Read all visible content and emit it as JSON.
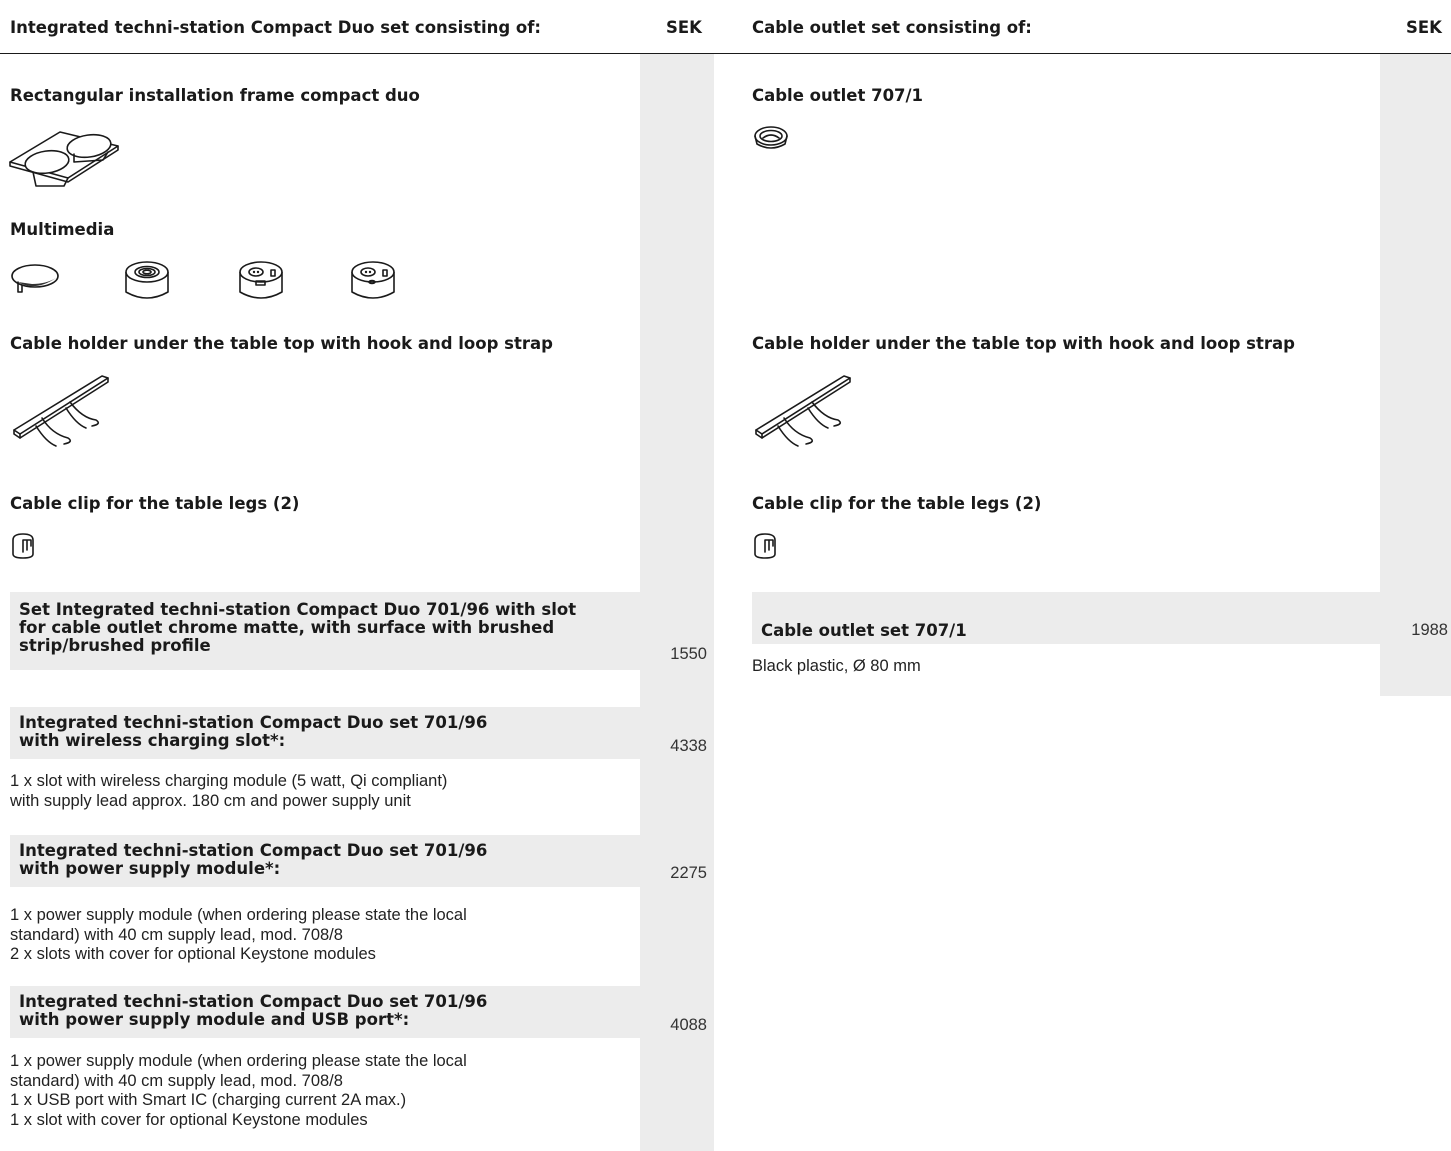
{
  "left": {
    "header": {
      "title": "Integrated techni-station Compact Duo set consisting of:",
      "currency": "SEK"
    },
    "sections": {
      "frame": "Rectangular installation frame compact duo",
      "multimedia": "Multimedia",
      "cable_holder": "Cable holder under the table top with hook and loop strap",
      "cable_clip": "Cable clip for the table legs (2)"
    },
    "items": [
      {
        "title_lines": [
          "Set Integrated techni-station Compact Duo 701/96 with slot",
          "for cable outlet chrome matte, with surface with brushed",
          "strip/brushed profile"
        ],
        "price": "1550",
        "desc_lines": []
      },
      {
        "title_lines": [
          "Integrated techni-station Compact Duo set 701/96",
          "with wireless charging slot*:"
        ],
        "price": "4338",
        "desc_lines": [
          "1 x slot with wireless charging module (5 watt, Qi compliant)",
          "with supply lead approx. 180 cm and power supply unit"
        ]
      },
      {
        "title_lines": [
          "Integrated techni-station Compact Duo set 701/96",
          "with power supply module*:"
        ],
        "price": "2275",
        "desc_lines": [
          "1 x power supply module (when ordering please state the local",
          "standard) with 40 cm supply lead, mod. 708/8",
          "2 x slots with cover for optional Keystone modules"
        ]
      },
      {
        "title_lines": [
          "Integrated techni-station Compact Duo set 701/96",
          "with power supply module and USB port*:"
        ],
        "price": "4088",
        "desc_lines": [
          "1 x power supply module (when ordering please state the local",
          "standard) with 40 cm supply lead, mod. 708/8",
          "1 x USB port with Smart IC (charging current 2A max.)",
          "1 x slot with cover for optional Keystone modules"
        ]
      }
    ]
  },
  "right": {
    "header": {
      "title": "Cable outlet set consisting of:",
      "currency": "SEK"
    },
    "sections": {
      "outlet": "Cable outlet 707/1",
      "cable_holder": "Cable holder under the table top with hook and loop strap",
      "cable_clip": "Cable clip for the table legs (2)"
    },
    "items": [
      {
        "title": "Cable outlet set 707/1",
        "price": "1988",
        "desc": "Black plastic, Ø 80 mm"
      }
    ]
  }
}
